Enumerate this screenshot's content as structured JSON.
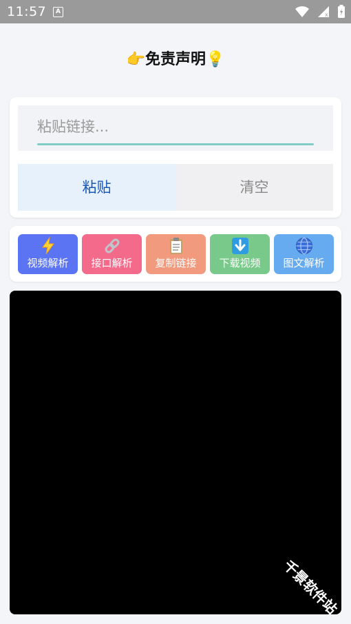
{
  "status_bar": {
    "time": "11:57",
    "a_icon_letter": "A"
  },
  "title": {
    "emoji_left": "👉",
    "text": "免责声明",
    "emoji_right": "💡"
  },
  "input": {
    "placeholder": "粘贴链接...",
    "value": ""
  },
  "buttons": {
    "paste": "粘贴",
    "clear": "清空"
  },
  "actions": [
    {
      "label": "视频解析",
      "emoji": "⚡",
      "color": "#5a74f4"
    },
    {
      "label": "接口解析",
      "emoji": "🔗",
      "color": "#f46a8a"
    },
    {
      "label": "复制链接",
      "emoji": "📋",
      "color": "#f29a7e"
    },
    {
      "label": "下载视频",
      "emoji": "⬇️",
      "color": "#79c98a"
    },
    {
      "label": "图文解析",
      "emoji": "🌐",
      "color": "#66aaf0"
    }
  ],
  "watermark": "千景软件站",
  "colors": {
    "accent_underline": "#7fcdc6",
    "paste_bg": "#e6f1fc",
    "paste_text": "#1a56b5"
  }
}
